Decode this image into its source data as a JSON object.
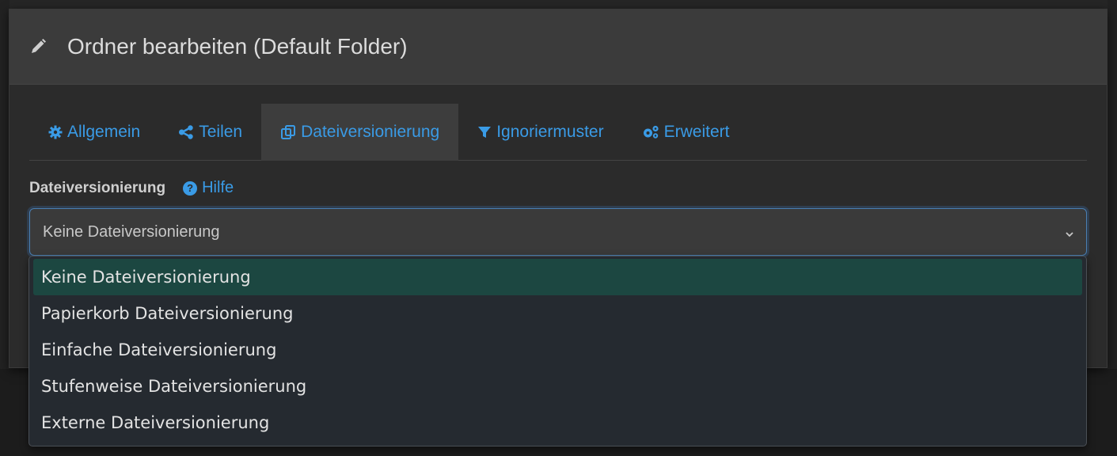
{
  "modal": {
    "title": "Ordner bearbeiten (Default Folder)"
  },
  "tabs": [
    {
      "label": "Allgemein",
      "icon": "gear-icon"
    },
    {
      "label": "Teilen",
      "icon": "share-icon"
    },
    {
      "label": "Dateiversionierung",
      "icon": "copy-icon",
      "active": true
    },
    {
      "label": "Ignoriermuster",
      "icon": "filter-icon"
    },
    {
      "label": "Erweitert",
      "icon": "gears-icon"
    }
  ],
  "versioning": {
    "label": "Dateiversionierung",
    "help_label": "Hilfe",
    "selected": "Keine Dateiversionierung",
    "options": [
      "Keine Dateiversionierung",
      "Papierkorb Dateiversionierung",
      "Einfache Dateiversionierung",
      "Stufenweise Dateiversionierung",
      "Externe Dateiversionierung"
    ]
  },
  "colors": {
    "accent": "#3a9be6",
    "selected_option": "#1c4741"
  }
}
